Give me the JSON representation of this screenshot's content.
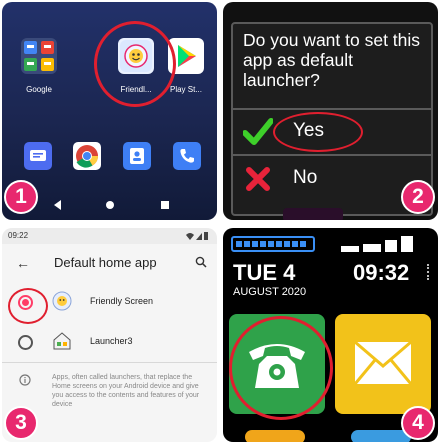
{
  "panel1": {
    "apps": [
      {
        "label": "Google",
        "icon": "google-folder-icon"
      },
      {
        "label": "Friendl...",
        "icon": "friendly-screen-app-icon"
      },
      {
        "label": "Play St...",
        "icon": "play-store-icon"
      }
    ],
    "dock": [
      {
        "icon": "messages-icon",
        "color": "#4d6cf0"
      },
      {
        "icon": "chrome-icon",
        "color": "#ffffff"
      },
      {
        "icon": "contacts-icon",
        "color": "#3e7ff5"
      },
      {
        "icon": "phone-icon",
        "color": "#3e7ff5"
      }
    ],
    "nav": [
      "back-icon",
      "home-icon",
      "recents-icon"
    ],
    "step": "1"
  },
  "panel2": {
    "question": "Do you want to set this app as default launcher?",
    "yes_label": "Yes",
    "no_label": "No",
    "step": "2"
  },
  "panel3": {
    "status_time": "09:22",
    "title": "Default home app",
    "options": [
      {
        "label": "Friendly Screen",
        "selected": true
      },
      {
        "label": "Launcher3",
        "selected": false
      }
    ],
    "info_text": "Apps, often called launchers, that replace the Home screens on your Android device and give you access to the contents and features of your device",
    "step": "3"
  },
  "panel4": {
    "day": "TUE 4",
    "time": "09:32",
    "date": "AUGUST 2020",
    "step": "4",
    "colors": {
      "phone_tile": "#2fa24a",
      "mail_tile": "#f2c21a"
    }
  },
  "colors": {
    "badge": "#e8286e",
    "ring": "#e01f2f",
    "accent": "#ff3d67"
  }
}
